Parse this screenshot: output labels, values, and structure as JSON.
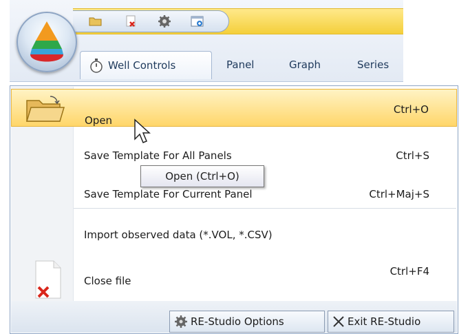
{
  "ribbon": {
    "tabs": [
      {
        "label": "Well Controls",
        "active": true
      },
      {
        "label": "Panel"
      },
      {
        "label": "Graph"
      },
      {
        "label": "Series"
      }
    ],
    "quick_access_icons": [
      "open-folder-icon",
      "close-file-icon",
      "gear-icon",
      "new-window-icon"
    ]
  },
  "menu": {
    "items": [
      {
        "label": "Open",
        "shortcut": "Ctrl+O",
        "icon": "open-folder-icon",
        "highlighted": true
      },
      {
        "label": "Save Template For All Panels",
        "shortcut": "Ctrl+S"
      },
      {
        "label": "Save Template For Current Panel",
        "shortcut": "Ctrl+Maj+S"
      },
      {
        "label": "Import observed data (*.VOL, *.CSV)",
        "shortcut": ""
      },
      {
        "label": "Close file",
        "shortcut": "Ctrl+F4",
        "icon": "close-file-icon"
      }
    ],
    "tooltip": "Open (Ctrl+O)",
    "footer": {
      "options_label": "RE-Studio Options",
      "exit_label": "Exit RE-Studio"
    }
  },
  "colors": {
    "highlight": "#ffd66a",
    "qat_bar": "#f4cf3b",
    "tab_text": "#1e395b",
    "close_red": "#d9261c"
  }
}
